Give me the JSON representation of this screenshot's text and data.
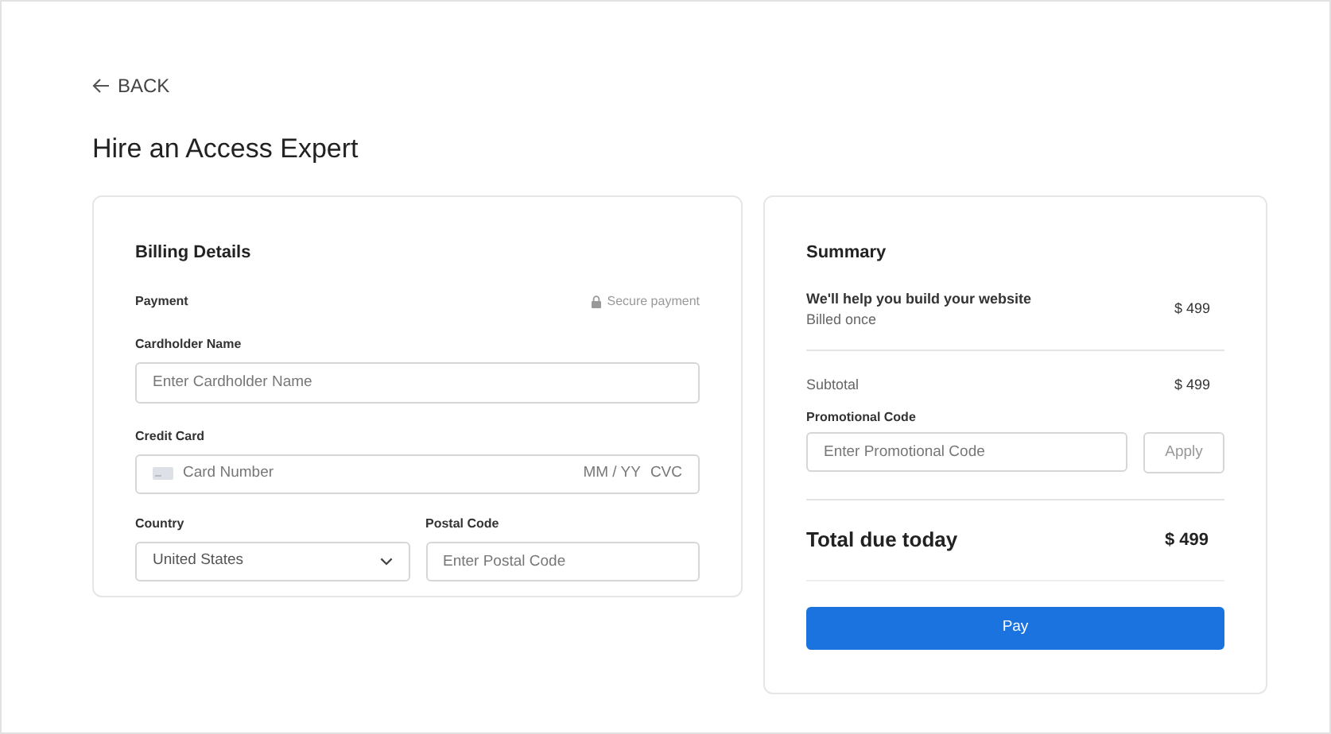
{
  "back_link": {
    "label": "BACK"
  },
  "page_title": "Hire an Access Expert",
  "billing": {
    "title": "Billing Details",
    "payment_label": "Payment",
    "secure_note": "Secure payment",
    "cardholder": {
      "label": "Cardholder Name",
      "placeholder": "Enter Cardholder Name"
    },
    "credit_card": {
      "label": "Credit Card",
      "placeholder": "Card Number",
      "expiry": "MM / YY",
      "cvc": "CVC"
    },
    "country": {
      "label": "Country",
      "value": "United States"
    },
    "postal": {
      "label": "Postal Code",
      "placeholder": "Enter Postal Code"
    }
  },
  "summary": {
    "title": "Summary",
    "item": {
      "name": "We'll help you build your website",
      "note": "Billed once",
      "price": "$ 499"
    },
    "subtotal": {
      "label": "Subtotal",
      "value": "$ 499"
    },
    "promo": {
      "label": "Promotional Code",
      "placeholder": "Enter Promotional Code",
      "button": "Apply"
    },
    "total": {
      "label": "Total due today",
      "value": "$ 499"
    },
    "pay_button": "Pay"
  }
}
